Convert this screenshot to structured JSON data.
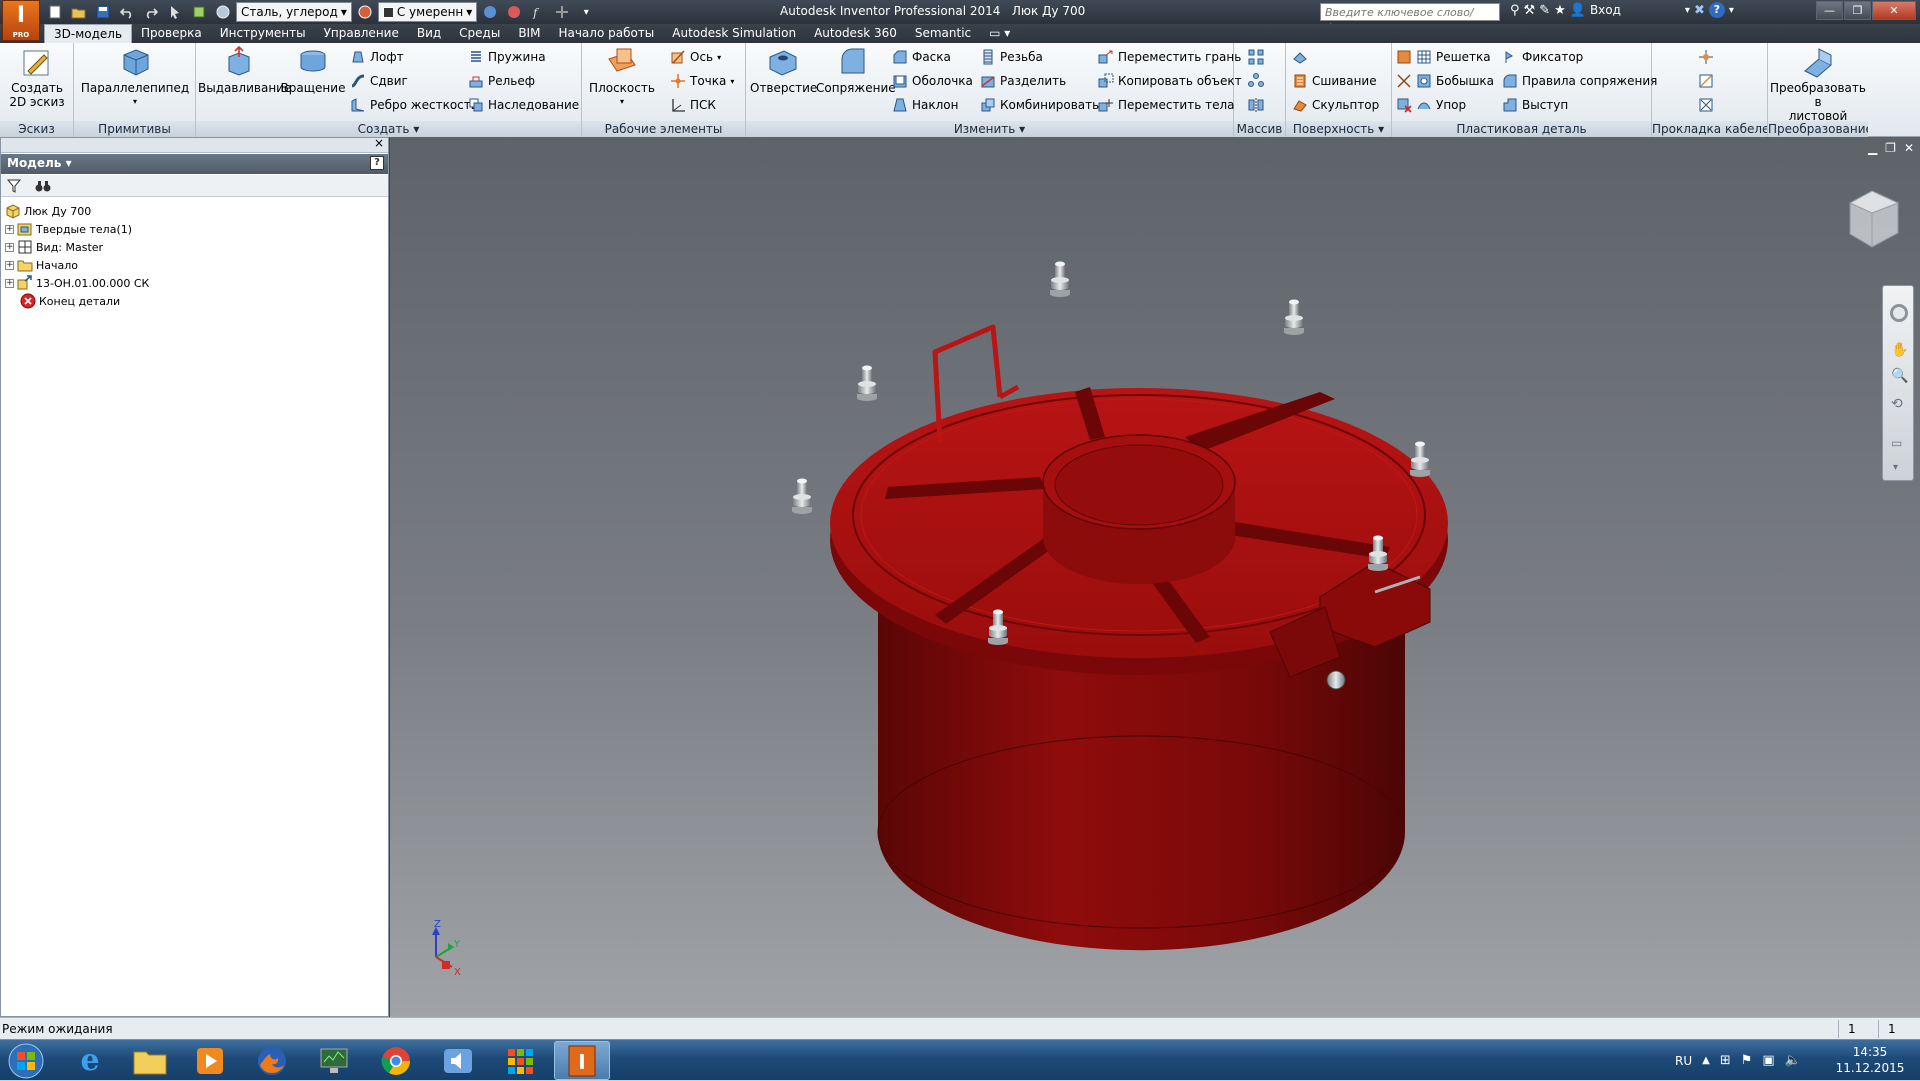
{
  "app": {
    "logo_letter": "I",
    "logo_sub": "PRO",
    "window_title": "Autodesk Inventor Professional 2014",
    "document_title": "Люк Ду 700",
    "search_placeholder": "Введите ключевое слово/фразу",
    "login_label": "Вход"
  },
  "qat": {
    "material": "Сталь, углерод",
    "appearance": "С умеренн"
  },
  "tabs": [
    {
      "label": "3D-модель",
      "active": true
    },
    {
      "label": "Проверка"
    },
    {
      "label": "Инструменты"
    },
    {
      "label": "Управление"
    },
    {
      "label": "Вид"
    },
    {
      "label": "Среды"
    },
    {
      "label": "BIM"
    },
    {
      "label": "Начало работы"
    },
    {
      "label": "Autodesk Simulation"
    },
    {
      "label": "Autodesk 360"
    },
    {
      "label": "Semantic"
    }
  ],
  "ribbon": {
    "sketch": {
      "label": "Эскиз",
      "create_sketch_1": "Создать",
      "create_sketch_2": "2D эскиз"
    },
    "primitives": {
      "label": "Примитивы",
      "box": "Параллелепипед"
    },
    "create": {
      "label": "Создать",
      "extrude": "Выдавливание",
      "revolve": "Вращение",
      "loft": "Лофт",
      "sweep": "Сдвиг",
      "rib": "Ребро жесткости",
      "coil": "Пружина",
      "emboss": "Рельеф",
      "derive": "Наследование"
    },
    "work": {
      "label": "Рабочие элементы",
      "plane": "Плоскость",
      "axis": "Ось",
      "point": "Точка",
      "ucs": "ПСК"
    },
    "modify": {
      "label": "Изменить",
      "hole": "Отверстие",
      "fillet": "Сопряжение",
      "chamfer": "Фаска",
      "shell": "Оболочка",
      "draft": "Наклон",
      "thread": "Резьба",
      "split": "Разделить",
      "combine": "Комбинировать",
      "move_face": "Переместить грань",
      "copy_object": "Копировать объект",
      "move_bodies": "Переместить тела"
    },
    "pattern": {
      "label": "Массив"
    },
    "surface": {
      "label": "Поверхность",
      "stitch": "Сшивание",
      "sculpt": "Скульптор"
    },
    "plastic": {
      "label": "Пластиковая деталь",
      "grill": "Решетка",
      "boss": "Бобышка",
      "rest": "Упор",
      "snap_fit": "Фиксатор",
      "rule_fillet": "Правила сопряжения",
      "lip": "Выступ"
    },
    "harness": {
      "label": "Прокладка кабелей"
    },
    "convert": {
      "label": "Преобразование",
      "sheet_1": "Преобразовать в",
      "sheet_2": "листовой металл"
    }
  },
  "browser": {
    "header": "Модель",
    "tree": [
      {
        "label": "Люк Ду 700",
        "level": 0,
        "expander": false,
        "icon": "part-icon"
      },
      {
        "label": "Твердые тела(1)",
        "level": 1,
        "expander": true,
        "icon": "solid-bodies-icon"
      },
      {
        "label": "Вид: Master",
        "level": 1,
        "expander": true,
        "icon": "view-icon"
      },
      {
        "label": "Начало",
        "level": 1,
        "expander": true,
        "icon": "folder-icon"
      },
      {
        "label": "13-ОН.01.00.000 СК",
        "level": 1,
        "expander": true,
        "icon": "derived-part-icon"
      },
      {
        "label": "Конец детали",
        "level": 1,
        "expander": false,
        "icon": "end-of-part-icon"
      }
    ]
  },
  "triad": {
    "x": "X",
    "y": "Y",
    "z": "Z"
  },
  "status": {
    "text": "Режим ожидания",
    "count_1": "1",
    "count_2": "1"
  },
  "taskbar": {
    "lang": "RU",
    "time": "14:35",
    "date": "11.12.2015"
  },
  "colors": {
    "model_red": "#a30c0c",
    "ribbon_bg": "#e9eef3",
    "viewport_top": "#5e6369"
  }
}
